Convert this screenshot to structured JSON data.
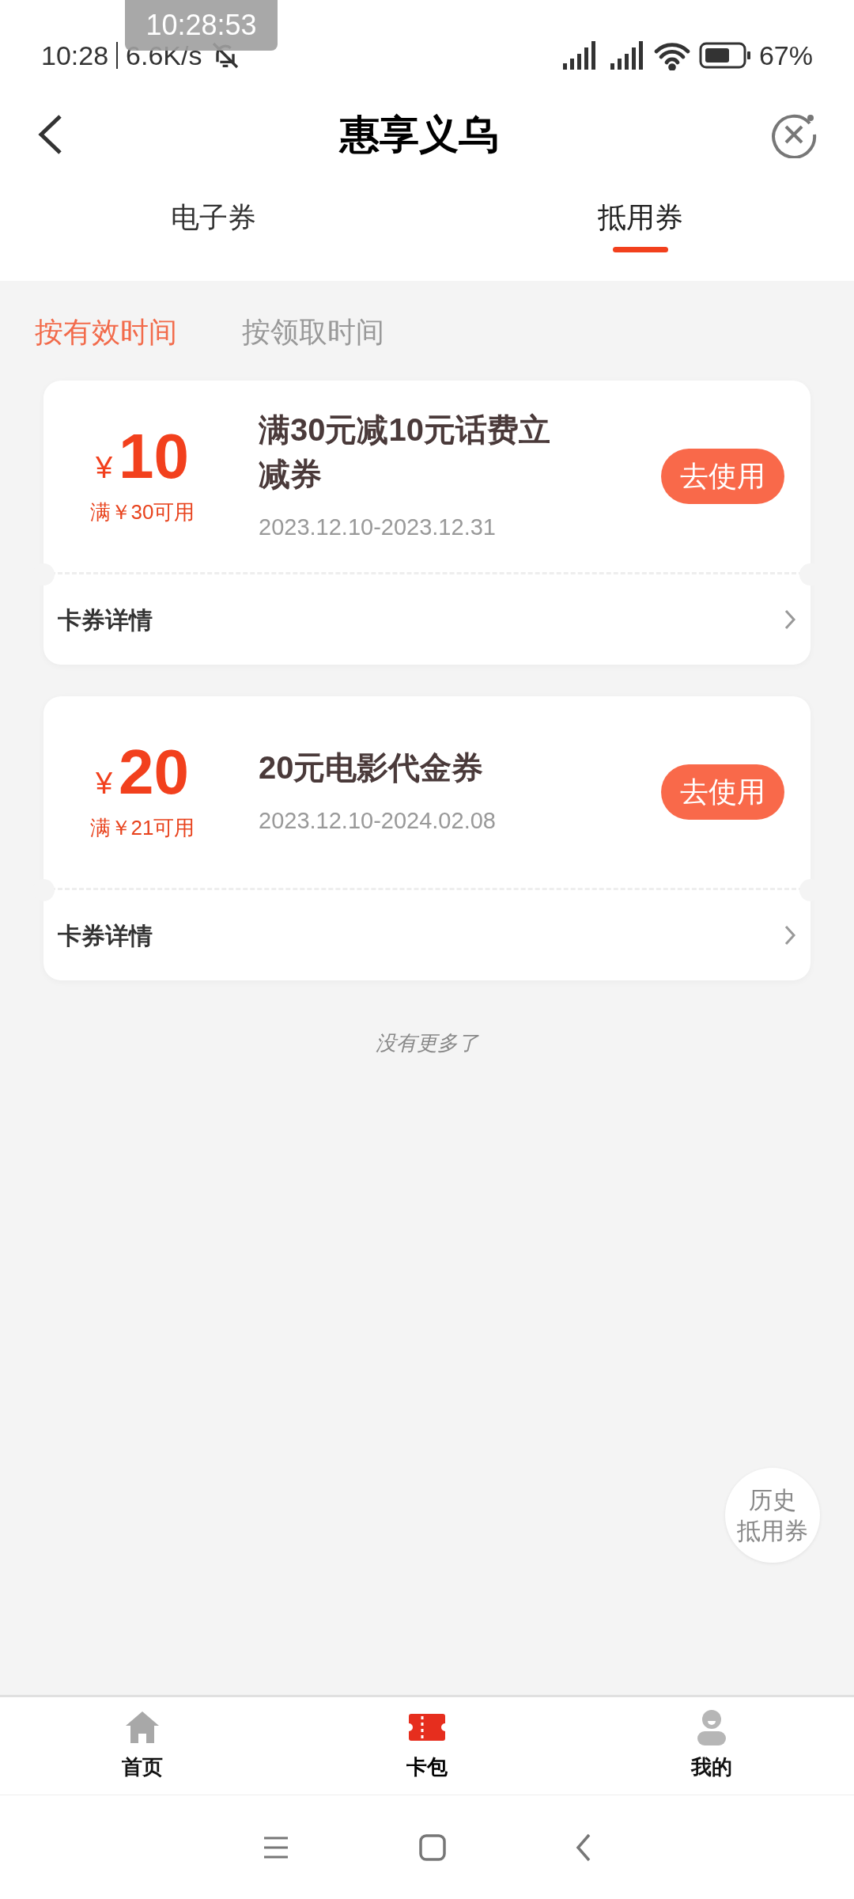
{
  "recording_overlay": "10:28:53",
  "status_bar": {
    "time": "10:28",
    "speed": "6.6K/s",
    "battery": "67%"
  },
  "header": {
    "title": "惠享义乌"
  },
  "tabs": [
    {
      "label": "电子券",
      "selected": false
    },
    {
      "label": "抵用券",
      "selected": true
    }
  ],
  "sort_options": [
    {
      "label": "按有效时间",
      "selected": true
    },
    {
      "label": "按领取时间",
      "selected": false
    }
  ],
  "coupons": [
    {
      "currency": "¥",
      "amount": "10",
      "condition": "满￥30可用",
      "title": "满30元减10元话费立减券",
      "validity": "2023.12.10-2023.12.31",
      "button": "去使用",
      "details": "卡券详情"
    },
    {
      "currency": "¥",
      "amount": "20",
      "condition": "满￥21可用",
      "title": "20元电影代金券",
      "validity": "2023.12.10-2024.02.08",
      "button": "去使用",
      "details": "卡券详情"
    }
  ],
  "end_note": "没有更多了",
  "history_button": [
    "历史",
    "抵用券"
  ],
  "bottom_nav": [
    {
      "label": "首页",
      "kind": "home",
      "selected": false
    },
    {
      "label": "卡包",
      "kind": "wallet",
      "selected": true
    },
    {
      "label": "我的",
      "kind": "profile",
      "selected": false
    }
  ]
}
